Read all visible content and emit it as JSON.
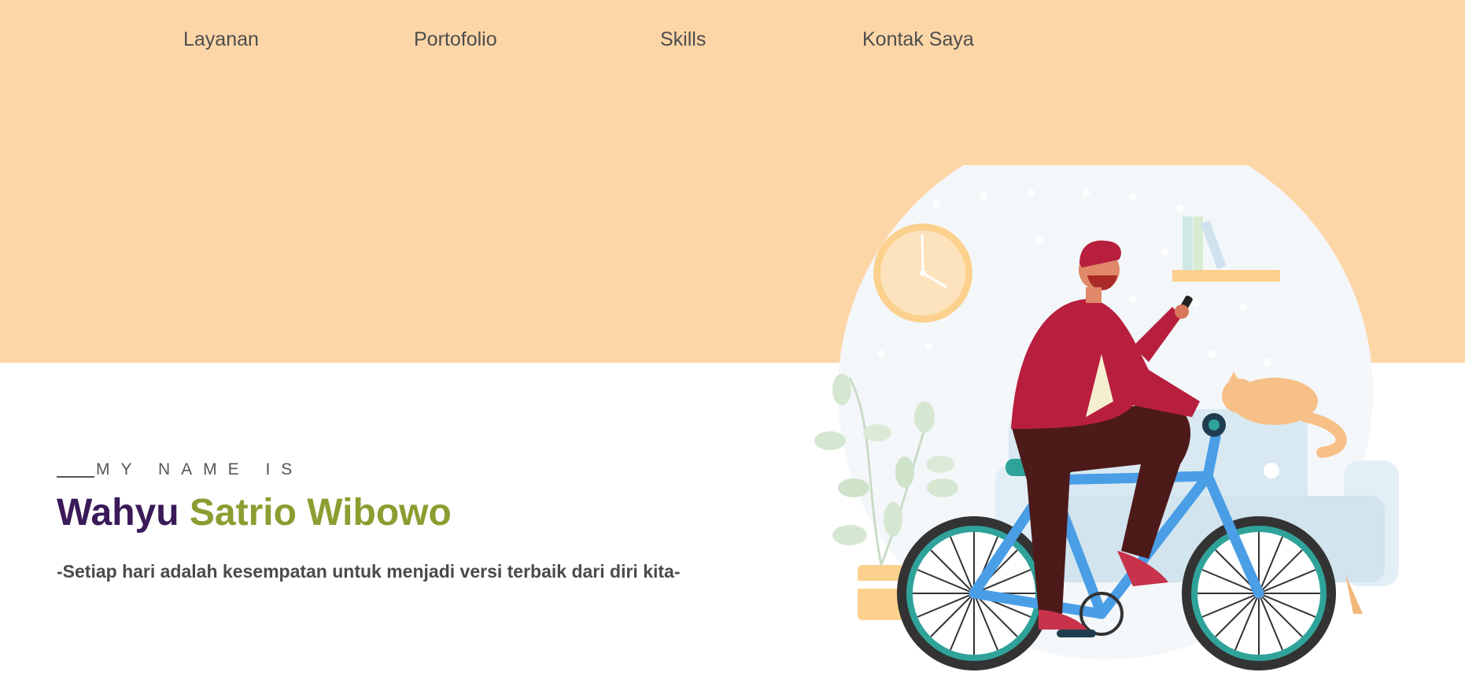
{
  "nav": {
    "items": [
      {
        "label": "Layanan"
      },
      {
        "label": "Portofolio"
      },
      {
        "label": "Skills"
      },
      {
        "label": "Kontak Saya"
      }
    ]
  },
  "hero": {
    "eyebrow": "MY NAME IS",
    "name_first": "Wahyu",
    "name_last": "Satrio Wibowo",
    "tagline": "-Setiap hari adalah kesempatan untuk menjadi versi terbaik dari diri kita-"
  },
  "colors": {
    "hero_background": "#fdd6a8",
    "name_first": "#3b1a59",
    "name_last": "#8a9e31",
    "nav_text": "#4d4d4d"
  },
  "illustration": {
    "icon": "man-riding-bicycle-illustration"
  }
}
